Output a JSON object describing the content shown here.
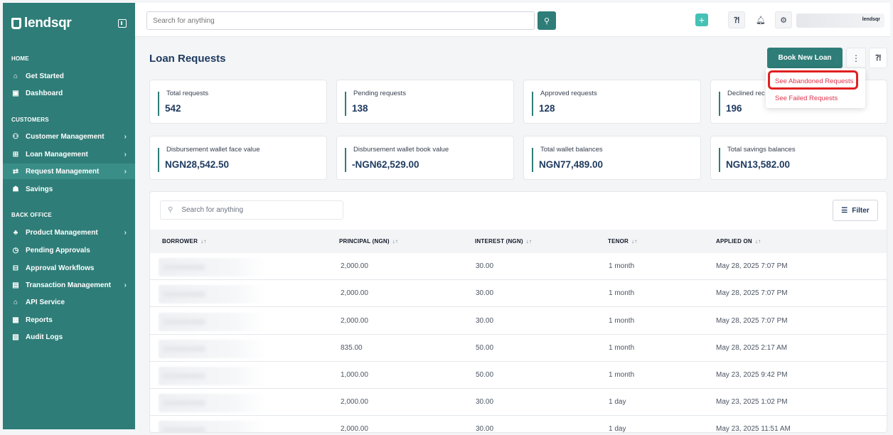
{
  "brand": {
    "name": "lendsqr",
    "small_logo": "lendsqr"
  },
  "sidebar": {
    "sections": {
      "home": "HOME",
      "customers": "CUSTOMERS",
      "back_office": "BACK OFFICE"
    },
    "items": [
      {
        "label": "Get Started",
        "icon": "home-icon"
      },
      {
        "label": "Dashboard",
        "icon": "dashboard-icon"
      },
      {
        "label": "Customer Management",
        "icon": "users-icon"
      },
      {
        "label": "Loan Management",
        "icon": "loan-icon"
      },
      {
        "label": "Request Management",
        "icon": "request-icon"
      },
      {
        "label": "Savings",
        "icon": "savings-icon"
      },
      {
        "label": "Product Management",
        "icon": "product-icon"
      },
      {
        "label": "Pending Approvals",
        "icon": "clock-icon"
      },
      {
        "label": "Approval Workflows",
        "icon": "workflow-icon"
      },
      {
        "label": "Transaction Management",
        "icon": "transaction-icon"
      },
      {
        "label": "API Service",
        "icon": "bank-icon"
      },
      {
        "label": "Reports",
        "icon": "reports-icon"
      },
      {
        "label": "Audit Logs",
        "icon": "audit-icon"
      }
    ]
  },
  "header": {
    "search_placeholder": "Search for anything"
  },
  "main": {
    "title": "Loan Requests",
    "book_button": "Book New Loan",
    "stats": [
      {
        "label": "Total requests",
        "value": "542"
      },
      {
        "label": "Pending requests",
        "value": "138"
      },
      {
        "label": "Approved requests",
        "value": "128"
      },
      {
        "label": "Declined rec",
        "value": "196"
      },
      {
        "label": "Disbursement wallet face value",
        "value": "NGN28,542.50"
      },
      {
        "label": "Disbursement wallet book value",
        "value": "-NGN62,529.00"
      },
      {
        "label": "Total wallet balances",
        "value": "NGN77,489.00"
      },
      {
        "label": "Total savings balances",
        "value": "NGN13,582.00"
      }
    ],
    "dropdown": [
      "See Abandoned Requests",
      "See Failed Requests"
    ]
  },
  "table": {
    "search_placeholder": "Search for anything",
    "filter_label": "Filter",
    "columns": [
      "BORROWER",
      "PRINCIPAL (NGN)",
      "INTEREST (NGN)",
      "TENOR",
      "APPLIED ON"
    ],
    "rows": [
      {
        "principal": "2,000.00",
        "interest": "30.00",
        "tenor": "1 month",
        "applied": "May 28, 2025 7:07 PM"
      },
      {
        "principal": "2,000.00",
        "interest": "30.00",
        "tenor": "1 month",
        "applied": "May 28, 2025 7:07 PM"
      },
      {
        "principal": "2,000.00",
        "interest": "30.00",
        "tenor": "1 month",
        "applied": "May 28, 2025 7:07 PM"
      },
      {
        "principal": "835.00",
        "interest": "50.00",
        "tenor": "1 month",
        "applied": "May 28, 2025 2:17 AM"
      },
      {
        "principal": "1,000.00",
        "interest": "50.00",
        "tenor": "1 month",
        "applied": "May 23, 2025 9:42 PM"
      },
      {
        "principal": "2,000.00",
        "interest": "30.00",
        "tenor": "1 day",
        "applied": "May 23, 2025 1:02 PM"
      },
      {
        "principal": "2,000.00",
        "interest": "30.00",
        "tenor": "1 day",
        "applied": "May 23, 2025 11:51 AM"
      }
    ]
  }
}
